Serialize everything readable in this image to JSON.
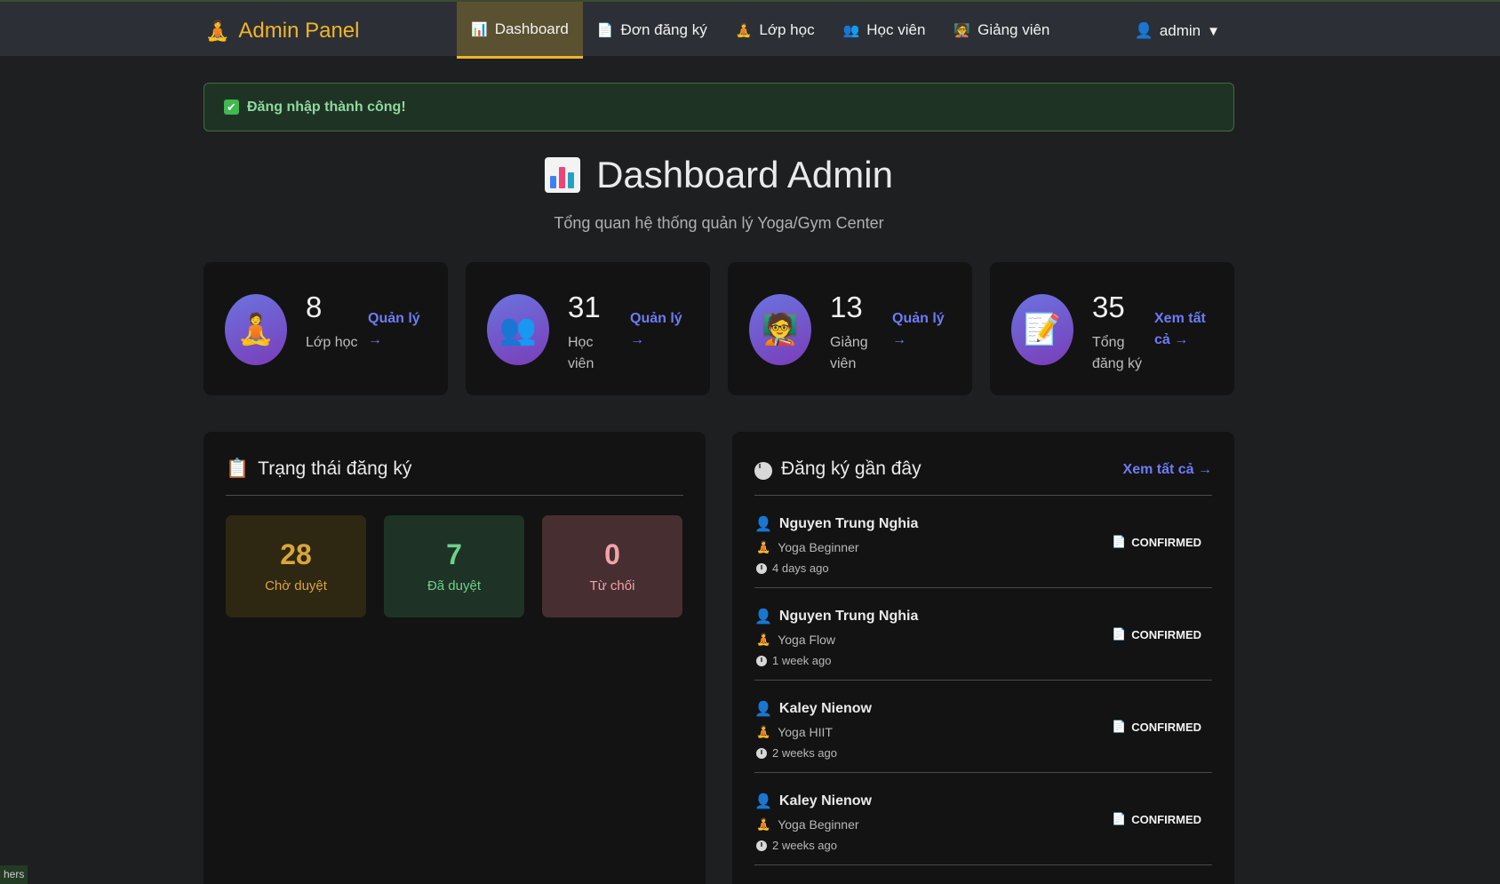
{
  "navbar": {
    "brand": "Admin Panel",
    "brand_icon": "🧘",
    "items": [
      {
        "label": "Dashboard",
        "icon": "📊",
        "active": true
      },
      {
        "label": "Đơn đăng ký",
        "icon": "📄"
      },
      {
        "label": "Lớp học",
        "icon": "🧘"
      },
      {
        "label": "Học viên",
        "icon": "👥"
      },
      {
        "label": "Giảng viên",
        "icon": "🧑‍🏫"
      }
    ],
    "user": {
      "label": "admin",
      "icon": "👤",
      "caret": "▼"
    }
  },
  "alert": {
    "text": "Đăng nhập thành công!",
    "icon": "✔"
  },
  "header": {
    "title": "Dashboard Admin",
    "subtitle": "Tổng quan hệ thống quản lý Yoga/Gym Center"
  },
  "stats": [
    {
      "value": "8",
      "label": "Lớp học",
      "link": "Quản lý →",
      "icon": "🧘"
    },
    {
      "value": "31",
      "label": "Học viên",
      "link": "Quản lý →",
      "icon": "👥"
    },
    {
      "value": "13",
      "label": "Giảng viên",
      "link": "Quản lý →",
      "icon": "🧑‍🏫"
    },
    {
      "value": "35",
      "label": "Tổng đăng ký",
      "link": "Xem tất cả →",
      "icon": "📝"
    }
  ],
  "status_panel": {
    "title": "Trạng thái đăng ký",
    "icon": "📋",
    "boxes": [
      {
        "value": "28",
        "label": "Chờ duyệt",
        "bg": "#2e2712",
        "color": "#d9a63a"
      },
      {
        "value": "7",
        "label": "Đã duyệt",
        "bg": "#1e3325",
        "color": "#6fd08a"
      },
      {
        "value": "0",
        "label": "Từ chối",
        "bg": "#472e31",
        "color": "#f2a3a8"
      }
    ]
  },
  "recent_panel": {
    "title": "Đăng ký gần đây",
    "link": "Xem tất cả →",
    "items": [
      {
        "name": "Nguyen Trung Nghia",
        "class": "Yoga Beginner",
        "ago": "4 days ago",
        "status": "CONFIRMED"
      },
      {
        "name": "Nguyen Trung Nghia",
        "class": "Yoga Flow",
        "ago": "1 week ago",
        "status": "CONFIRMED"
      },
      {
        "name": "Kaley Nienow",
        "class": "Yoga HIIT",
        "ago": "2 weeks ago",
        "status": "CONFIRMED"
      },
      {
        "name": "Kaley Nienow",
        "class": "Yoga Beginner",
        "ago": "2 weeks ago",
        "status": "CONFIRMED"
      }
    ]
  },
  "corner_tag": "hers"
}
